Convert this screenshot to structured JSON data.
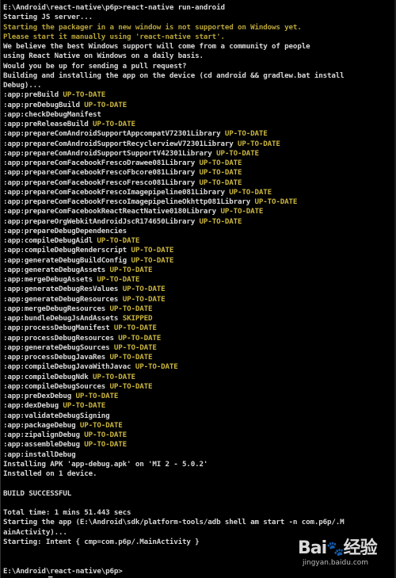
{
  "terminal": {
    "lines": [
      {
        "text": "E:\\Android\\react-native\\p6p>react-native run-android",
        "status": "",
        "kind": "normal"
      },
      {
        "text": "Starting JS server...",
        "status": "",
        "kind": "normal"
      },
      {
        "text": "Starting the packager in a new window is not supported on Windows yet.",
        "status": "",
        "kind": "warn"
      },
      {
        "text": "Please start it manually using 'react-native start'.",
        "status": "",
        "kind": "warn"
      },
      {
        "text": "We believe the best Windows support will come from a community of people",
        "status": "",
        "kind": "normal"
      },
      {
        "text": "using React Native on Windows on a daily basis.",
        "status": "",
        "kind": "normal"
      },
      {
        "text": "Would you be up for sending a pull request?",
        "status": "",
        "kind": "normal"
      },
      {
        "text": "Building and installing the app on the device (cd android && gradlew.bat install",
        "status": "",
        "kind": "normal"
      },
      {
        "text": "Debug)...",
        "status": "",
        "kind": "normal"
      },
      {
        "text": ":app:preBuild ",
        "status": "UP-TO-DATE",
        "kind": "normal"
      },
      {
        "text": ":app:preDebugBuild ",
        "status": "UP-TO-DATE",
        "kind": "normal"
      },
      {
        "text": ":app:checkDebugManifest",
        "status": "",
        "kind": "normal"
      },
      {
        "text": ":app:preReleaseBuild ",
        "status": "UP-TO-DATE",
        "kind": "normal"
      },
      {
        "text": ":app:prepareComAndroidSupportAppcompatV72301Library ",
        "status": "UP-TO-DATE",
        "kind": "normal"
      },
      {
        "text": ":app:prepareComAndroidSupportRecyclerviewV72301Library ",
        "status": "UP-TO-DATE",
        "kind": "normal"
      },
      {
        "text": ":app:prepareComAndroidSupportSupportV42301Library ",
        "status": "UP-TO-DATE",
        "kind": "normal"
      },
      {
        "text": ":app:prepareComFacebookFrescoDrawee081Library ",
        "status": "UP-TO-DATE",
        "kind": "normal"
      },
      {
        "text": ":app:prepareComFacebookFrescoFbcore081Library ",
        "status": "UP-TO-DATE",
        "kind": "normal"
      },
      {
        "text": ":app:prepareComFacebookFrescoFresco081Library ",
        "status": "UP-TO-DATE",
        "kind": "normal"
      },
      {
        "text": ":app:prepareComFacebookFrescoImagepipeline081Library ",
        "status": "UP-TO-DATE",
        "kind": "normal"
      },
      {
        "text": ":app:prepareComFacebookFrescoImagepipelineOkhttp081Library ",
        "status": "UP-TO-DATE",
        "kind": "normal"
      },
      {
        "text": ":app:prepareComFacebookReactReactNative0180Library ",
        "status": "UP-TO-DATE",
        "kind": "normal"
      },
      {
        "text": ":app:prepareOrgWebkitAndroidJscR174650Library ",
        "status": "UP-TO-DATE",
        "kind": "normal"
      },
      {
        "text": ":app:prepareDebugDependencies",
        "status": "",
        "kind": "normal"
      },
      {
        "text": ":app:compileDebugAidl ",
        "status": "UP-TO-DATE",
        "kind": "normal"
      },
      {
        "text": ":app:compileDebugRenderscript ",
        "status": "UP-TO-DATE",
        "kind": "normal"
      },
      {
        "text": ":app:generateDebugBuildConfig ",
        "status": "UP-TO-DATE",
        "kind": "normal"
      },
      {
        "text": ":app:generateDebugAssets ",
        "status": "UP-TO-DATE",
        "kind": "normal"
      },
      {
        "text": ":app:mergeDebugAssets ",
        "status": "UP-TO-DATE",
        "kind": "normal"
      },
      {
        "text": ":app:generateDebugResValues ",
        "status": "UP-TO-DATE",
        "kind": "normal"
      },
      {
        "text": ":app:generateDebugResources ",
        "status": "UP-TO-DATE",
        "kind": "normal"
      },
      {
        "text": ":app:mergeDebugResources ",
        "status": "UP-TO-DATE",
        "kind": "normal"
      },
      {
        "text": ":app:bundleDebugJsAndAssets ",
        "status": "SKIPPED",
        "kind": "normal"
      },
      {
        "text": ":app:processDebugManifest ",
        "status": "UP-TO-DATE",
        "kind": "normal"
      },
      {
        "text": ":app:processDebugResources ",
        "status": "UP-TO-DATE",
        "kind": "normal"
      },
      {
        "text": ":app:generateDebugSources ",
        "status": "UP-TO-DATE",
        "kind": "normal"
      },
      {
        "text": ":app:processDebugJavaRes ",
        "status": "UP-TO-DATE",
        "kind": "normal"
      },
      {
        "text": ":app:compileDebugJavaWithJavac ",
        "status": "UP-TO-DATE",
        "kind": "normal"
      },
      {
        "text": ":app:compileDebugNdk ",
        "status": "UP-TO-DATE",
        "kind": "normal"
      },
      {
        "text": ":app:compileDebugSources ",
        "status": "UP-TO-DATE",
        "kind": "normal"
      },
      {
        "text": ":app:preDexDebug ",
        "status": "UP-TO-DATE",
        "kind": "normal"
      },
      {
        "text": ":app:dexDebug ",
        "status": "UP-TO-DATE",
        "kind": "normal"
      },
      {
        "text": ":app:validateDebugSigning",
        "status": "",
        "kind": "normal"
      },
      {
        "text": ":app:packageDebug ",
        "status": "UP-TO-DATE",
        "kind": "normal"
      },
      {
        "text": ":app:zipalignDebug ",
        "status": "UP-TO-DATE",
        "kind": "normal"
      },
      {
        "text": ":app:assembleDebug ",
        "status": "UP-TO-DATE",
        "kind": "normal"
      },
      {
        "text": ":app:installDebug",
        "status": "",
        "kind": "normal"
      },
      {
        "text": "Installing APK 'app-debug.apk' on 'MI 2 - 5.0.2'",
        "status": "",
        "kind": "normal"
      },
      {
        "text": "Installed on 1 device.",
        "status": "",
        "kind": "normal"
      },
      {
        "text": "",
        "status": "",
        "kind": "normal"
      },
      {
        "text": "BUILD SUCCESSFUL",
        "status": "",
        "kind": "normal"
      },
      {
        "text": "",
        "status": "",
        "kind": "normal"
      },
      {
        "text": "Total time: 1 mins 51.443 secs",
        "status": "",
        "kind": "normal"
      },
      {
        "text": "Starting the app (E:\\Android\\sdk/platform-tools/adb shell am start -n com.p6p/.M",
        "status": "",
        "kind": "normal"
      },
      {
        "text": "ainActivity)...",
        "status": "",
        "kind": "normal"
      },
      {
        "text": "Starting: Intent { cmp=com.p6p/.MainActivity }",
        "status": "",
        "kind": "normal"
      },
      {
        "text": "",
        "status": "",
        "kind": "normal"
      },
      {
        "text": "",
        "status": "",
        "kind": "normal"
      },
      {
        "text": "E:\\Android\\react-native\\p6p>",
        "status": "",
        "kind": "normal"
      }
    ]
  },
  "watermark": {
    "logo_text": "Bai",
    "logo_paw": "෗",
    "logo_suffix": "经验",
    "url": "jingyan.baidu.com"
  },
  "colors": {
    "background": "#000000",
    "text": "#d8d8d8",
    "status": "#c9b43e",
    "warning": "#b8a43a"
  }
}
